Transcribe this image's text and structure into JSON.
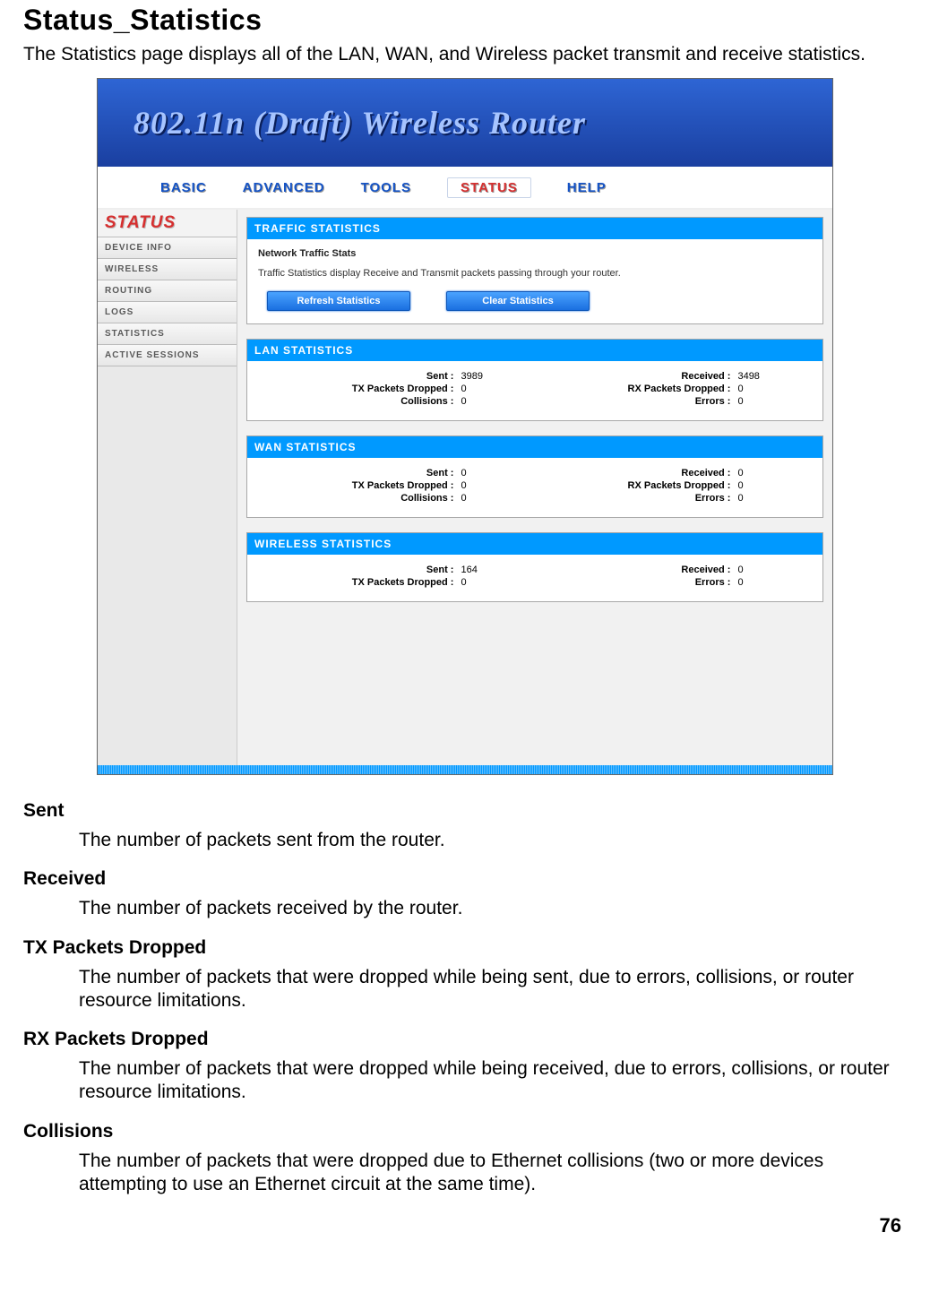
{
  "page": {
    "title": "Status_Statistics",
    "intro": "The Statistics page displays all of the LAN, WAN, and Wireless packet transmit and receive statistics.",
    "number": "76"
  },
  "screenshot": {
    "headerTitle": "802.11n (Draft) Wireless Router",
    "nav": {
      "items": [
        "BASIC",
        "ADVANCED",
        "TOOLS",
        "STATUS",
        "HELP"
      ],
      "activeIndex": 3
    },
    "sidebar": {
      "header": "STATUS",
      "items": [
        "DEVICE INFO",
        "WIRELESS",
        "ROUTING",
        "LOGS",
        "STATISTICS",
        "ACTIVE SESSIONS"
      ]
    },
    "traffic": {
      "title": "TRAFFIC STATISTICS",
      "subtitle": "Network Traffic Stats",
      "description": "Traffic Statistics display Receive and Transmit packets passing through your router.",
      "buttons": {
        "refresh": "Refresh Statistics",
        "clear": "Clear Statistics"
      }
    },
    "lan": {
      "title": "LAN STATISTICS",
      "sentLabel": "Sent :",
      "sent": "3989",
      "receivedLabel": "Received :",
      "received": "3498",
      "txDropLabel": "TX Packets Dropped :",
      "txDrop": "0",
      "rxDropLabel": "RX Packets Dropped :",
      "rxDrop": "0",
      "collisionsLabel": "Collisions :",
      "collisions": "0",
      "errorsLabel": "Errors :",
      "errors": "0"
    },
    "wan": {
      "title": "WAN STATISTICS",
      "sentLabel": "Sent :",
      "sent": "0",
      "receivedLabel": "Received :",
      "received": "0",
      "txDropLabel": "TX Packets Dropped :",
      "txDrop": "0",
      "rxDropLabel": "RX Packets Dropped :",
      "rxDrop": "0",
      "collisionsLabel": "Collisions :",
      "collisions": "0",
      "errorsLabel": "Errors :",
      "errors": "0"
    },
    "wireless": {
      "title": "WIRELESS STATISTICS",
      "sentLabel": "Sent :",
      "sent": "164",
      "receivedLabel": "Received :",
      "received": "0",
      "txDropLabel": "TX Packets Dropped :",
      "txDrop": "0",
      "errorsLabel": "Errors :",
      "errors": "0"
    }
  },
  "definitions": [
    {
      "term": "Sent",
      "desc": "The number of packets sent from the router."
    },
    {
      "term": "Received",
      "desc": "The number of packets received by the router."
    },
    {
      "term": "TX Packets Dropped",
      "desc": "The number of packets that were dropped while being sent, due to errors, collisions, or router resource limitations."
    },
    {
      "term": "RX Packets Dropped",
      "desc": "The number of packets that were dropped while being received, due to errors, collisions, or router resource limitations."
    },
    {
      "term": "Collisions",
      "desc": "The number of packets that were dropped due to Ethernet collisions (two or more devices attempting to use an Ethernet circuit at the same time)."
    }
  ]
}
